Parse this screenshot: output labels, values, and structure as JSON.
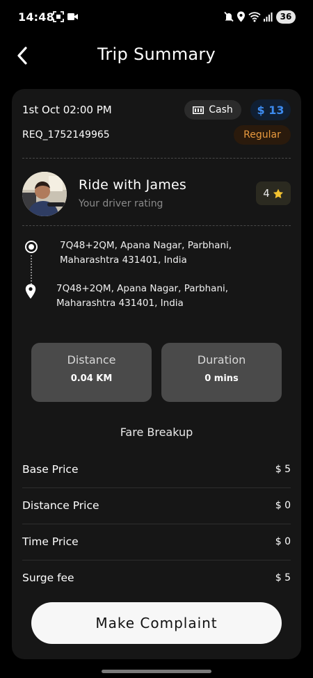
{
  "status_bar": {
    "time": "14:48",
    "battery": "36"
  },
  "header": {
    "title": "Trip Summary"
  },
  "trip": {
    "date_time": "1st Oct 02:00 PM",
    "payment_method": "Cash",
    "price": "$ 13",
    "request_id": "REQ_1752149965",
    "ride_type": "Regular"
  },
  "driver": {
    "title": "Ride with James",
    "subtitle": "Your driver rating",
    "rating": "4"
  },
  "route": {
    "pickup": "7Q48+2QM, Apana Nagar, Parbhani, Maharashtra 431401, India",
    "drop": "7Q48+2QM, Apana Nagar, Parbhani, Maharashtra 431401, India"
  },
  "stats": {
    "distance_label": "Distance",
    "distance_value": "0.04 KM",
    "duration_label": "Duration",
    "duration_value": "0 mins"
  },
  "fare": {
    "title": "Fare Breakup",
    "rows": [
      {
        "label": "Base Price",
        "amount": "$ 5"
      },
      {
        "label": "Distance Price",
        "amount": "$ 0"
      },
      {
        "label": "Time Price",
        "amount": "$ 0"
      },
      {
        "label": "Surge fee",
        "amount": "$ 5"
      }
    ]
  },
  "actions": {
    "complaint_label": "Make Complaint"
  },
  "colors": {
    "background": "#000000",
    "card": "#161616",
    "price_accent": "#3d8bef",
    "ride_type_accent": "#e99a3e",
    "star": "#f2c230"
  }
}
